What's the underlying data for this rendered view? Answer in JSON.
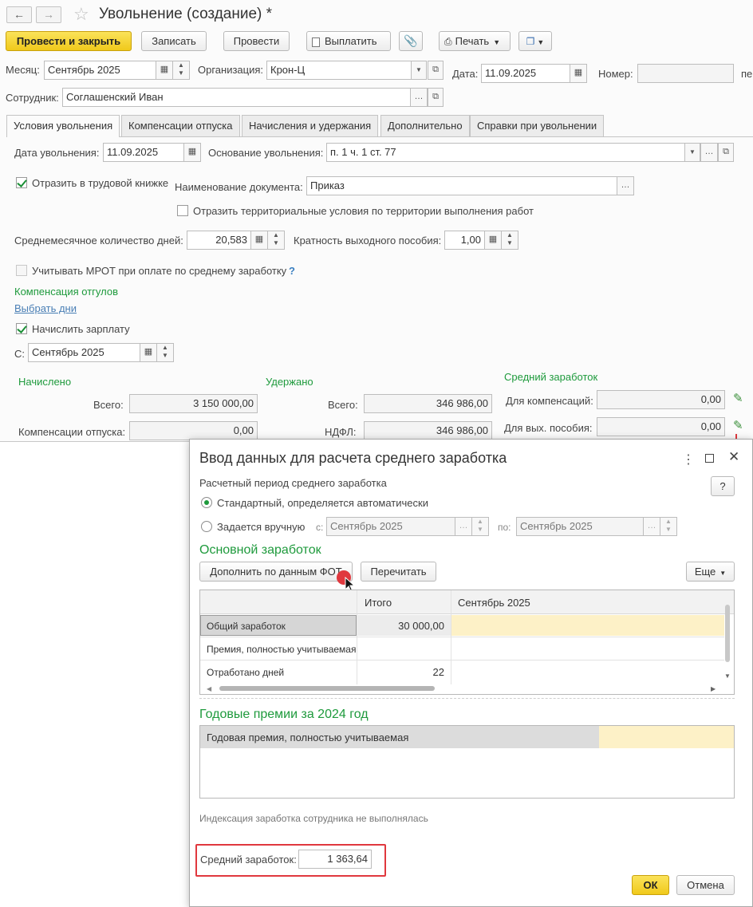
{
  "window": {
    "title": "Увольнение (создание) *"
  },
  "toolbar": {
    "post_close": "Провести и закрыть",
    "save": "Записать",
    "post": "Провести",
    "pay": "Выплатить",
    "print": "Печать"
  },
  "header": {
    "month_label": "Месяц:",
    "month_value": "Сентябрь 2025",
    "org_label": "Организация:",
    "org_value": "Крон-Ц",
    "date_label": "Дата:",
    "date_value": "11.09.2025",
    "number_label": "Номер:",
    "number_value": "",
    "suffix": "пе",
    "employee_label": "Сотрудник:",
    "employee_value": "Соглашенский Иван"
  },
  "tabs": [
    "Условия увольнения",
    "Компенсации отпуска",
    "Начисления и удержания",
    "Дополнительно",
    "Справки при увольнении"
  ],
  "conditions": {
    "dismissal_date_label": "Дата увольнения:",
    "dismissal_date": "11.09.2025",
    "basis_label": "Основание увольнения:",
    "basis_value": "п. 1 ч. 1 ст. 77",
    "workbook_label": "Отразить в трудовой книжке",
    "doc_name_label": "Наименование документа:",
    "doc_name_value": "Приказ",
    "territorial_label": "Отразить территориальные условия по территории выполнения работ",
    "avg_days_label": "Среднемесячное количество дней:",
    "avg_days_value": "20,583",
    "severance_mult_label": "Кратность выходного пособия:",
    "severance_mult_value": "1,00",
    "mrot_label": "Учитывать МРОТ при оплате по среднему заработку",
    "help_q": "?",
    "comp_time_title": "Компенсация отгулов",
    "choose_days": "Выбрать дни",
    "accrue_salary_label": "Начислить зарплату",
    "from_label": "С:",
    "from_value": "Сентябрь 2025"
  },
  "totals": {
    "accrued_title": "Начислено",
    "withheld_title": "Удержано",
    "avg_title": "Средний заработок",
    "total_label": "Всего:",
    "accrued_total": "3 150 000,00",
    "vacation_comp_label": "Компенсации отпуска:",
    "vacation_comp_value": "0,00",
    "withheld_total_label": "Всего:",
    "withheld_total": "346 986,00",
    "ndfl_label": "НДФЛ:",
    "ndfl_value": "346 986,00",
    "for_comp_label": "Для компенсаций:",
    "for_comp_value": "0,00",
    "for_severance_label": "Для вых. пособия:",
    "for_severance_value": "0,00"
  },
  "dialog": {
    "title": "Ввод данных для расчета среднего заработка",
    "help": "?",
    "period_title": "Расчетный период среднего заработка",
    "standard_label": "Стандартный, определяется автоматически",
    "manual_label": "Задается вручную",
    "from_label": "с:",
    "from_value": "Сентябрь 2025",
    "to_label": "по:",
    "to_value": "Сентябрь 2025",
    "main_earnings_title": "Основной заработок",
    "fill_button": "Дополнить по данным ФОТ",
    "recalc_button": "Перечитать",
    "more_button": "Еще",
    "table": {
      "headers": [
        "",
        "Итого",
        "Сентябрь 2025"
      ],
      "rows": [
        {
          "name": "Общий заработок",
          "total": "30 000,00",
          "month": ""
        },
        {
          "name": "Премия, полностью учитываемая",
          "total": "",
          "month": ""
        },
        {
          "name": "Отработано дней",
          "total": "22",
          "month": ""
        }
      ]
    },
    "bonus_title": "Годовые премии за 2024 год",
    "bonus_row": "Годовая премия, полностью учитываемая",
    "indexation_note": "Индексация заработка сотрудника не выполнялась",
    "avg_label": "Средний заработок:",
    "avg_value": "1 363,64",
    "ok": "ОК",
    "cancel": "Отмена"
  },
  "colors": {
    "accent_green": "#1e9a3c",
    "highlight_red": "#e0383e",
    "button_yellow": "#f5d42c",
    "cell_yellow": "#fdf1c7"
  }
}
